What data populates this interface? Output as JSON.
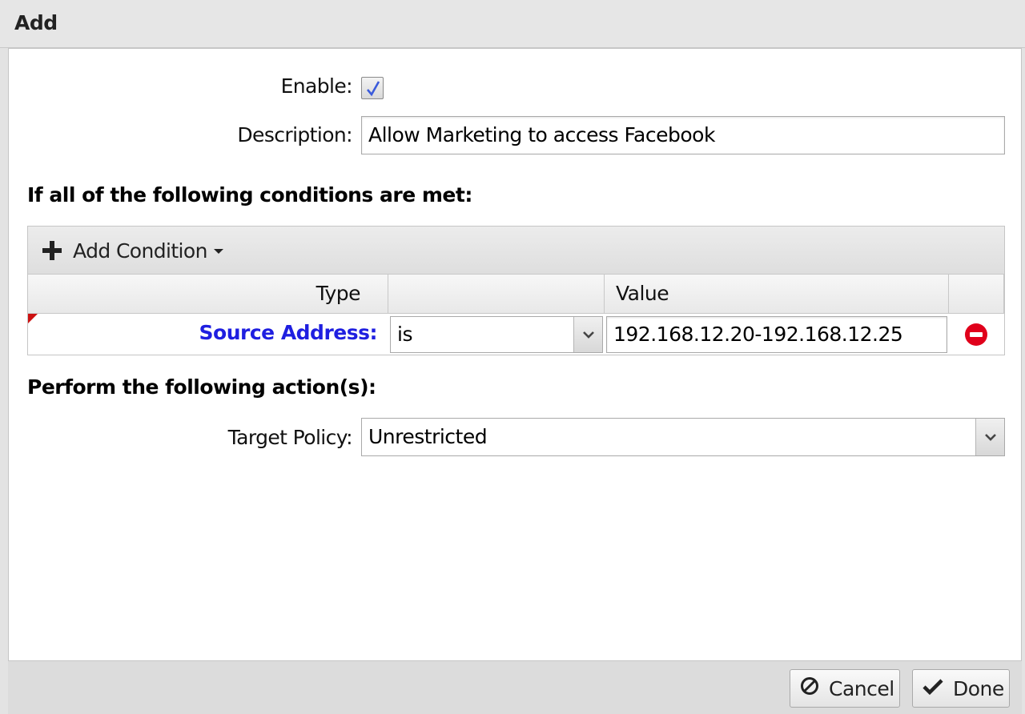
{
  "dialog": {
    "title": "Add"
  },
  "form": {
    "enable_label": "Enable:",
    "enable_checked": true,
    "description_label": "Description:",
    "description_value": "Allow Marketing to access Facebook"
  },
  "conditions": {
    "heading": "If all of the following conditions are met:",
    "add_condition_label": "Add Condition",
    "columns": {
      "type": "Type",
      "operator": "",
      "value": "Value",
      "actions": ""
    },
    "rows": [
      {
        "type": "Source Address:",
        "operator": "is",
        "value": "192.168.12.20-192.168.12.25"
      }
    ]
  },
  "actions": {
    "heading": "Perform the following action(s):",
    "target_policy_label": "Target Policy:",
    "target_policy_value": "Unrestricted"
  },
  "footer": {
    "cancel_label": "Cancel",
    "done_label": "Done"
  },
  "colors": {
    "condition_type": "#1f1fe0",
    "remove_icon": "#e0001b",
    "dirty_marker": "#cc1111"
  }
}
